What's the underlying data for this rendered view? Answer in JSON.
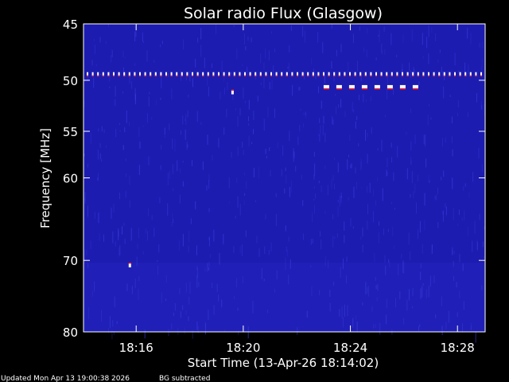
{
  "chart_data": {
    "type": "heatmap",
    "title": "Solar radio Flux (Glasgow)",
    "xlabel": "Start Time (13-Apr-26 18:14:02)",
    "ylabel": "Frequency [MHz]",
    "x_start": "18:14:02",
    "x_end": "18:29:02",
    "x_ticks": [
      "18:16",
      "18:20",
      "18:24",
      "18:28"
    ],
    "y_ticks": [
      "45",
      "50",
      "55",
      "60",
      "70",
      "80"
    ],
    "y_range_mhz": [
      45,
      80
    ],
    "y_scale": "log",
    "colors": {
      "background": "#1c1cb0",
      "noise": "#3a3ae0",
      "burst": "#ffffff",
      "burst_edge": "#ff2020"
    },
    "interference": [
      {
        "type": "band",
        "freq_mhz": 49.4,
        "time_range": [
          "18:14:02",
          "18:29:02"
        ]
      },
      {
        "type": "pulse-row",
        "freq_mhz": 50.6,
        "time_range": [
          "18:23:00",
          "18:26:35"
        ]
      },
      {
        "type": "spot",
        "freq_mhz": 51.1,
        "time": "18:19:35"
      },
      {
        "type": "spot",
        "freq_mhz": 70.6,
        "time": "18:15:45"
      }
    ]
  },
  "footer": {
    "updated": "Updated Mon Apr 13 19:00:38 2026",
    "note": "BG subtracted"
  }
}
